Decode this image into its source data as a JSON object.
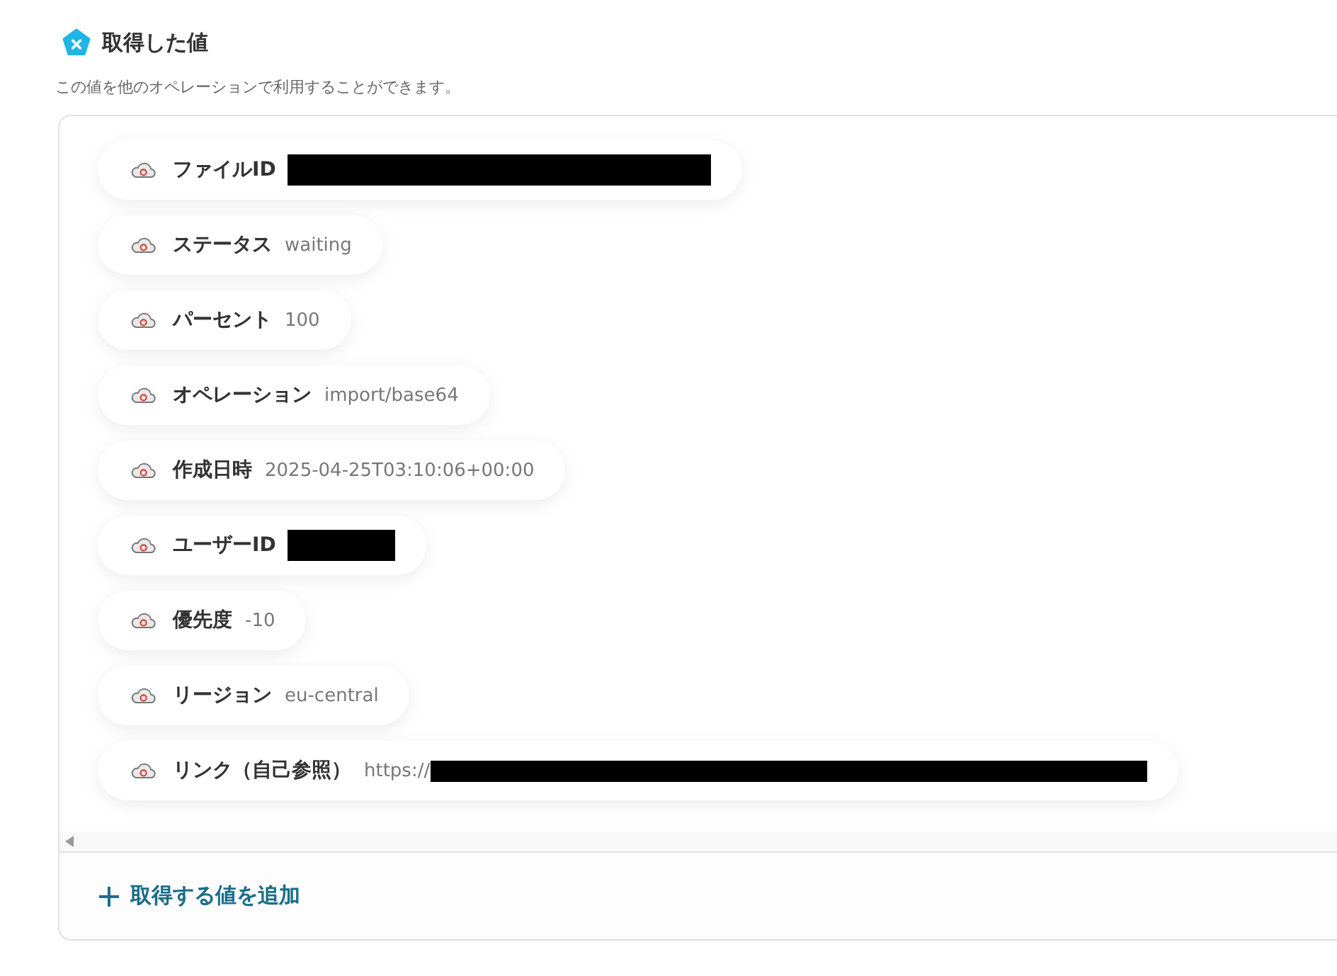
{
  "header": {
    "title": "取得した値",
    "description": "この値を他のオペレーションで利用することができます。"
  },
  "values": [
    {
      "label": "ファイルID",
      "redacted": true
    },
    {
      "label": "ステータス",
      "value": "waiting",
      "redacted": false
    },
    {
      "label": "パーセント",
      "value": "100",
      "redacted": false
    },
    {
      "label": "オペレーション",
      "value": "import/base64",
      "redacted": false
    },
    {
      "label": "作成日時",
      "value": "2025-04-25T03:10:06+00:00",
      "redacted": false
    },
    {
      "label": "ユーザーID",
      "redacted": true
    },
    {
      "label": "優先度",
      "value": "-10",
      "redacted": false
    },
    {
      "label": "リージョン",
      "value": "eu-central",
      "redacted": false
    },
    {
      "label": "リンク（自己参照）",
      "value": "https://",
      "redacted": true
    }
  ],
  "add_button": {
    "label": "取得する値を追加"
  }
}
